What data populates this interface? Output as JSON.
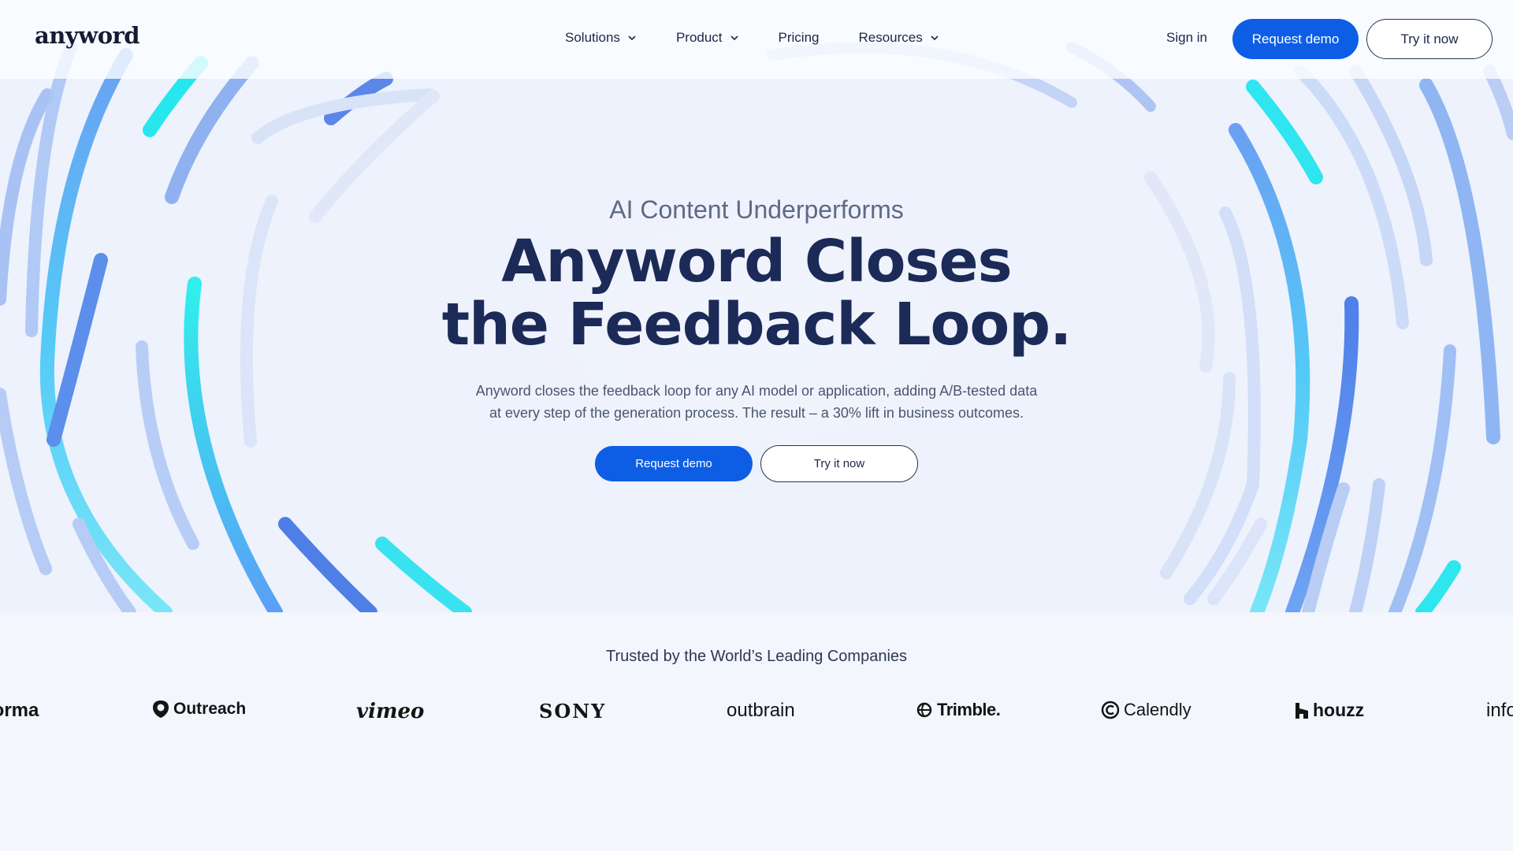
{
  "nav": {
    "logo": "anyword",
    "links": [
      {
        "label": "Solutions",
        "has_dropdown": true
      },
      {
        "label": "Product",
        "has_dropdown": true
      },
      {
        "label": "Pricing",
        "has_dropdown": false
      },
      {
        "label": "Resources",
        "has_dropdown": true
      }
    ],
    "sign_in": "Sign in",
    "request_demo": "Request demo",
    "try_it_now": "Try it now"
  },
  "hero": {
    "eyebrow": "AI Content Underperforms",
    "headline_line1": "Anyword Closes",
    "headline_line2": "the Feedback Loop.",
    "subtext_line1": "Anyword closes the feedback loop for any AI model or application, adding A/B-tested data",
    "subtext_line2": "at every step of the generation process. The result – a 30% lift in business outcomes.",
    "request_demo": "Request demo",
    "try_it_now": "Try it now"
  },
  "trusted": {
    "heading": "Trusted by the World’s Leading Companies",
    "logos": [
      "Forma",
      "Outreach",
      "vimeo",
      "SONY",
      "outbrain",
      "Trimble.",
      "Calendly",
      "houzz",
      "info"
    ]
  },
  "colors": {
    "primary_button": "#0d5ee5",
    "headline": "#1b2a56",
    "hero_bg": "#edf2fc",
    "ring_cyan": "#2fe6f0",
    "ring_blue": "#5b8cf0",
    "ring_light": "#b9cdf5"
  }
}
